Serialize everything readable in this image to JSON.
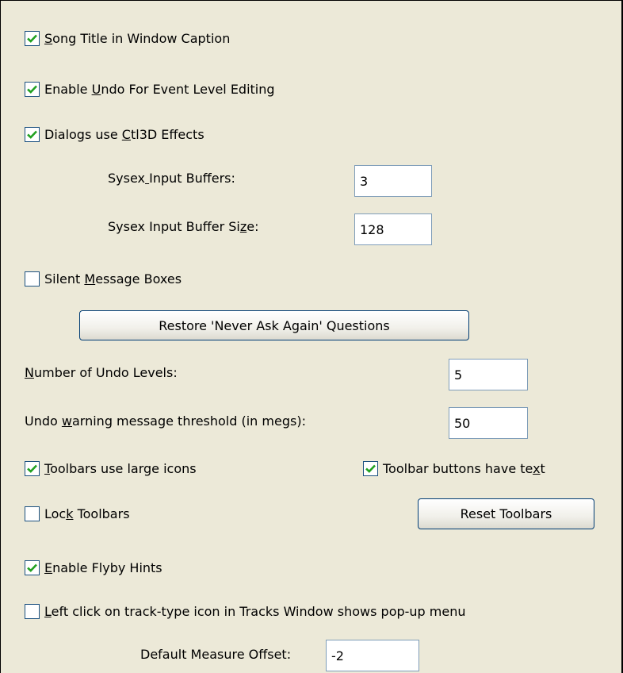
{
  "colors": {
    "panel_bg": "#ece9d8",
    "checkbox_border": "#1c5180",
    "checkmark": "#21a121",
    "field_border": "#7f9db9",
    "button_border": "#003c74"
  },
  "icons": {
    "checkmark": "check-icon"
  },
  "options": {
    "song_title": {
      "label": "Song Title in Window Caption",
      "checked": true
    },
    "enable_undo": {
      "label": "Enable Undo For Event Level Editing",
      "checked": true
    },
    "ctl3d": {
      "label": "Dialogs use Ctl3D Effects",
      "checked": true
    },
    "silent_message": {
      "label": "Silent Message Boxes",
      "checked": false
    },
    "large_icons": {
      "label": "Toolbars use large icons",
      "checked": true
    },
    "button_text": {
      "label": "Toolbar buttons have text",
      "checked": true
    },
    "lock_toolbars": {
      "label": "Lock Toolbars",
      "checked": false
    },
    "flyby_hints": {
      "label": "Enable Flyby Hints",
      "checked": true
    },
    "left_click": {
      "label": "Left click on track-type icon in Tracks Window shows pop-up menu",
      "checked": false
    }
  },
  "fields": {
    "sysex_buffers": {
      "label": "Sysex Input Buffers:",
      "value": "3"
    },
    "sysex_size": {
      "label": "Sysex Input Buffer Size:",
      "value": "128"
    },
    "undo_levels": {
      "label": "Number of Undo Levels:",
      "value": "5"
    },
    "undo_threshold": {
      "label": "Undo warning message threshold (in megs):",
      "value": "50"
    },
    "measure_offset": {
      "label": "Default Measure Offset:",
      "value": "-2"
    }
  },
  "buttons": {
    "restore": "Restore 'Never Ask Again' Questions",
    "reset_toolbars": "Reset Toolbars"
  }
}
